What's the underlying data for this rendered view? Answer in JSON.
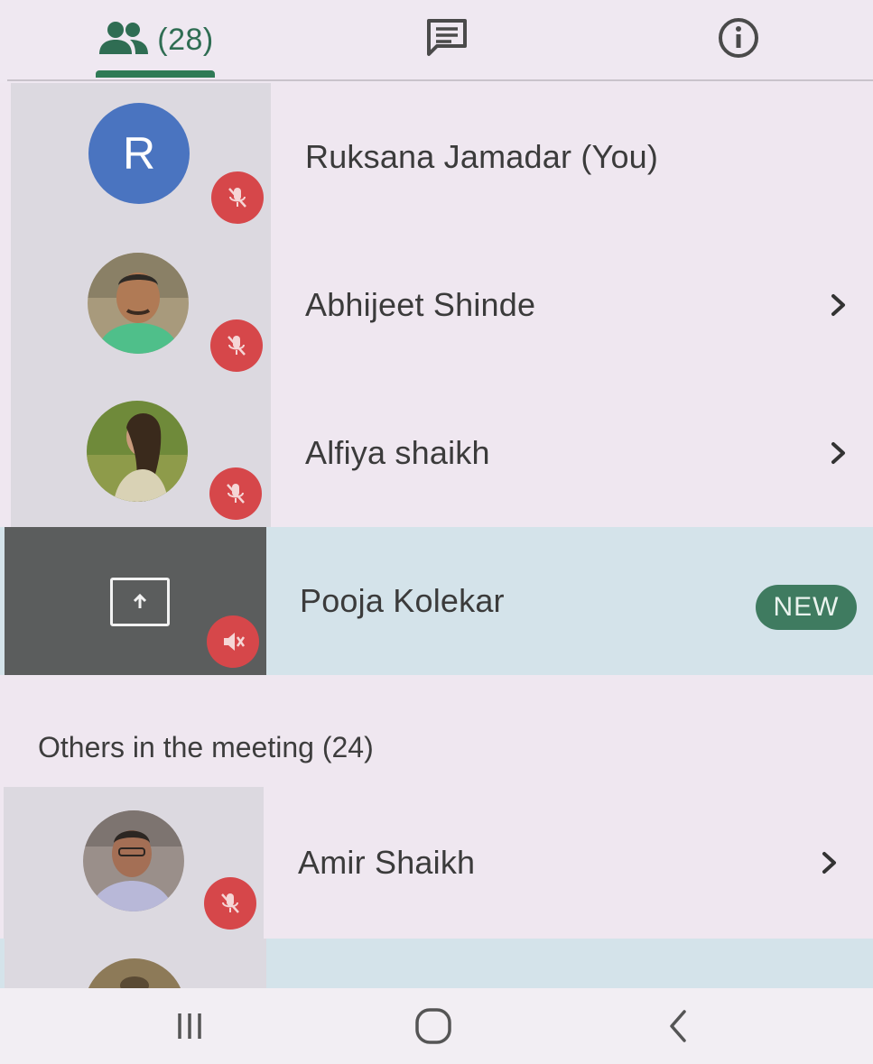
{
  "tabs": {
    "people_count": "(28)",
    "people_icon": "people-icon",
    "chat_icon": "chat-icon",
    "info_icon": "info-icon",
    "active_tab": "people",
    "accent_color": "#2f7a56"
  },
  "participants": [
    {
      "name": "Ruksana Jamadar (You)",
      "avatar_letter": "R",
      "muted": true
    },
    {
      "name": "Abhijeet Shinde",
      "muted": true
    },
    {
      "name": "Alfiya shaikh",
      "muted": true
    },
    {
      "name": "Pooja Kolekar",
      "presenting": true,
      "badge": "NEW"
    }
  ],
  "others_section": {
    "title": "Others in the meeting (24)",
    "participants": [
      {
        "name": "Amir Shaikh",
        "muted": true
      }
    ]
  },
  "colors": {
    "muted_red": "#d6474a",
    "new_badge": "#3f7b60",
    "highlight_row": "#d4e3ea",
    "letter_avatar": "#4a74c0"
  }
}
